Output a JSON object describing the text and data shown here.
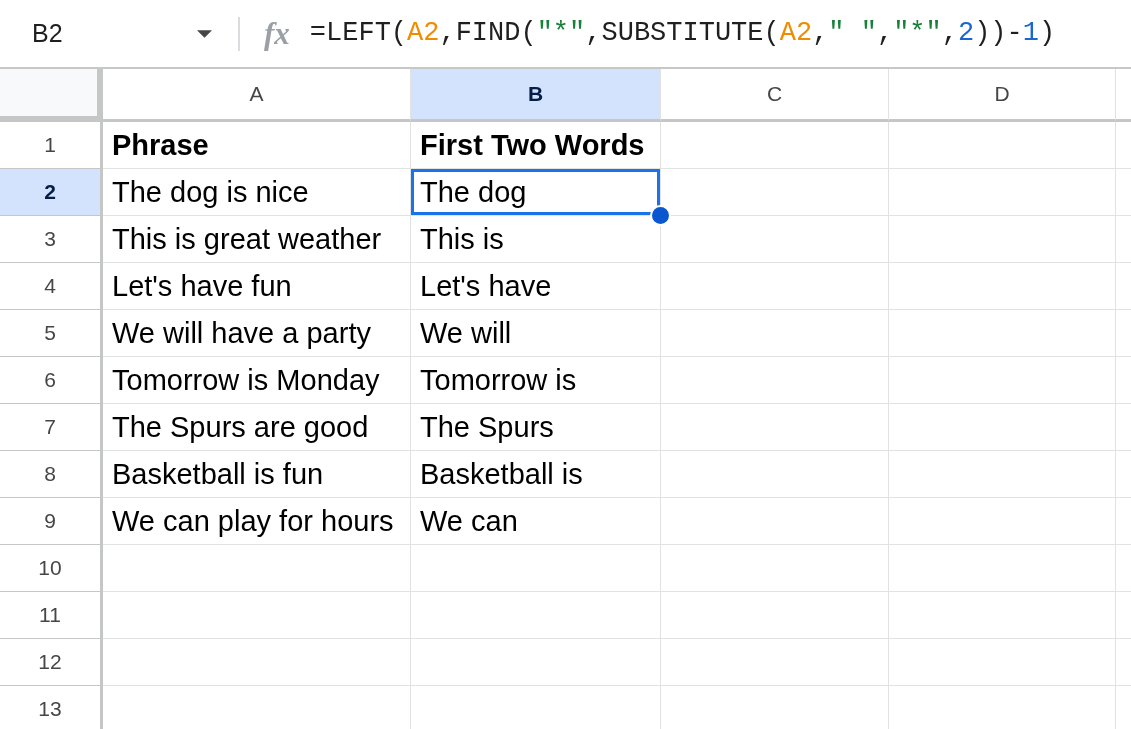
{
  "name_box": {
    "value": "B2"
  },
  "formula_bar": {
    "icon_text": "fx",
    "tokens": [
      {
        "text": "=LEFT(",
        "kind": "plain"
      },
      {
        "text": "A2",
        "kind": "reference"
      },
      {
        "text": ",FIND(",
        "kind": "plain"
      },
      {
        "text": "\"*\"",
        "kind": "string"
      },
      {
        "text": ",SUBSTITUTE(",
        "kind": "plain"
      },
      {
        "text": "A2",
        "kind": "reference"
      },
      {
        "text": ",",
        "kind": "plain"
      },
      {
        "text": "\" \"",
        "kind": "string"
      },
      {
        "text": ",",
        "kind": "plain"
      },
      {
        "text": "\"*\"",
        "kind": "string"
      },
      {
        "text": ",",
        "kind": "plain"
      },
      {
        "text": "2",
        "kind": "number"
      },
      {
        "text": "))-",
        "kind": "plain"
      },
      {
        "text": "1",
        "kind": "number"
      },
      {
        "text": ")",
        "kind": "plain"
      }
    ]
  },
  "columns": [
    {
      "label": "A",
      "selected": false
    },
    {
      "label": "B",
      "selected": true
    },
    {
      "label": "C",
      "selected": false
    },
    {
      "label": "D",
      "selected": false
    }
  ],
  "rows": [
    {
      "label": "1",
      "selected": false,
      "cells": [
        {
          "text": "Phrase",
          "bold": true,
          "selected": false
        },
        {
          "text": "First Two Words",
          "bold": true,
          "selected": false
        }
      ]
    },
    {
      "label": "2",
      "selected": true,
      "cells": [
        {
          "text": "The dog is nice",
          "bold": false,
          "selected": false
        },
        {
          "text": "The dog",
          "bold": false,
          "selected": true
        }
      ]
    },
    {
      "label": "3",
      "selected": false,
      "cells": [
        {
          "text": "This is great weather",
          "bold": false,
          "selected": false
        },
        {
          "text": "This is",
          "bold": false,
          "selected": false
        }
      ]
    },
    {
      "label": "4",
      "selected": false,
      "cells": [
        {
          "text": "Let's have fun",
          "bold": false,
          "selected": false
        },
        {
          "text": "Let's have",
          "bold": false,
          "selected": false
        }
      ]
    },
    {
      "label": "5",
      "selected": false,
      "cells": [
        {
          "text": "We will have a party",
          "bold": false,
          "selected": false
        },
        {
          "text": "We will",
          "bold": false,
          "selected": false
        }
      ]
    },
    {
      "label": "6",
      "selected": false,
      "cells": [
        {
          "text": "Tomorrow is Monday",
          "bold": false,
          "selected": false
        },
        {
          "text": "Tomorrow is",
          "bold": false,
          "selected": false
        }
      ]
    },
    {
      "label": "7",
      "selected": false,
      "cells": [
        {
          "text": "The Spurs are good",
          "bold": false,
          "selected": false
        },
        {
          "text": "The Spurs",
          "bold": false,
          "selected": false
        }
      ]
    },
    {
      "label": "8",
      "selected": false,
      "cells": [
        {
          "text": "Basketball is fun",
          "bold": false,
          "selected": false
        },
        {
          "text": "Basketball is",
          "bold": false,
          "selected": false
        }
      ]
    },
    {
      "label": "9",
      "selected": false,
      "cells": [
        {
          "text": "We can play for hours",
          "bold": false,
          "selected": false
        },
        {
          "text": "We can",
          "bold": false,
          "selected": false
        }
      ]
    },
    {
      "label": "10",
      "selected": false
    },
    {
      "label": "11",
      "selected": false
    },
    {
      "label": "12",
      "selected": false
    },
    {
      "label": "13",
      "selected": false
    }
  ]
}
